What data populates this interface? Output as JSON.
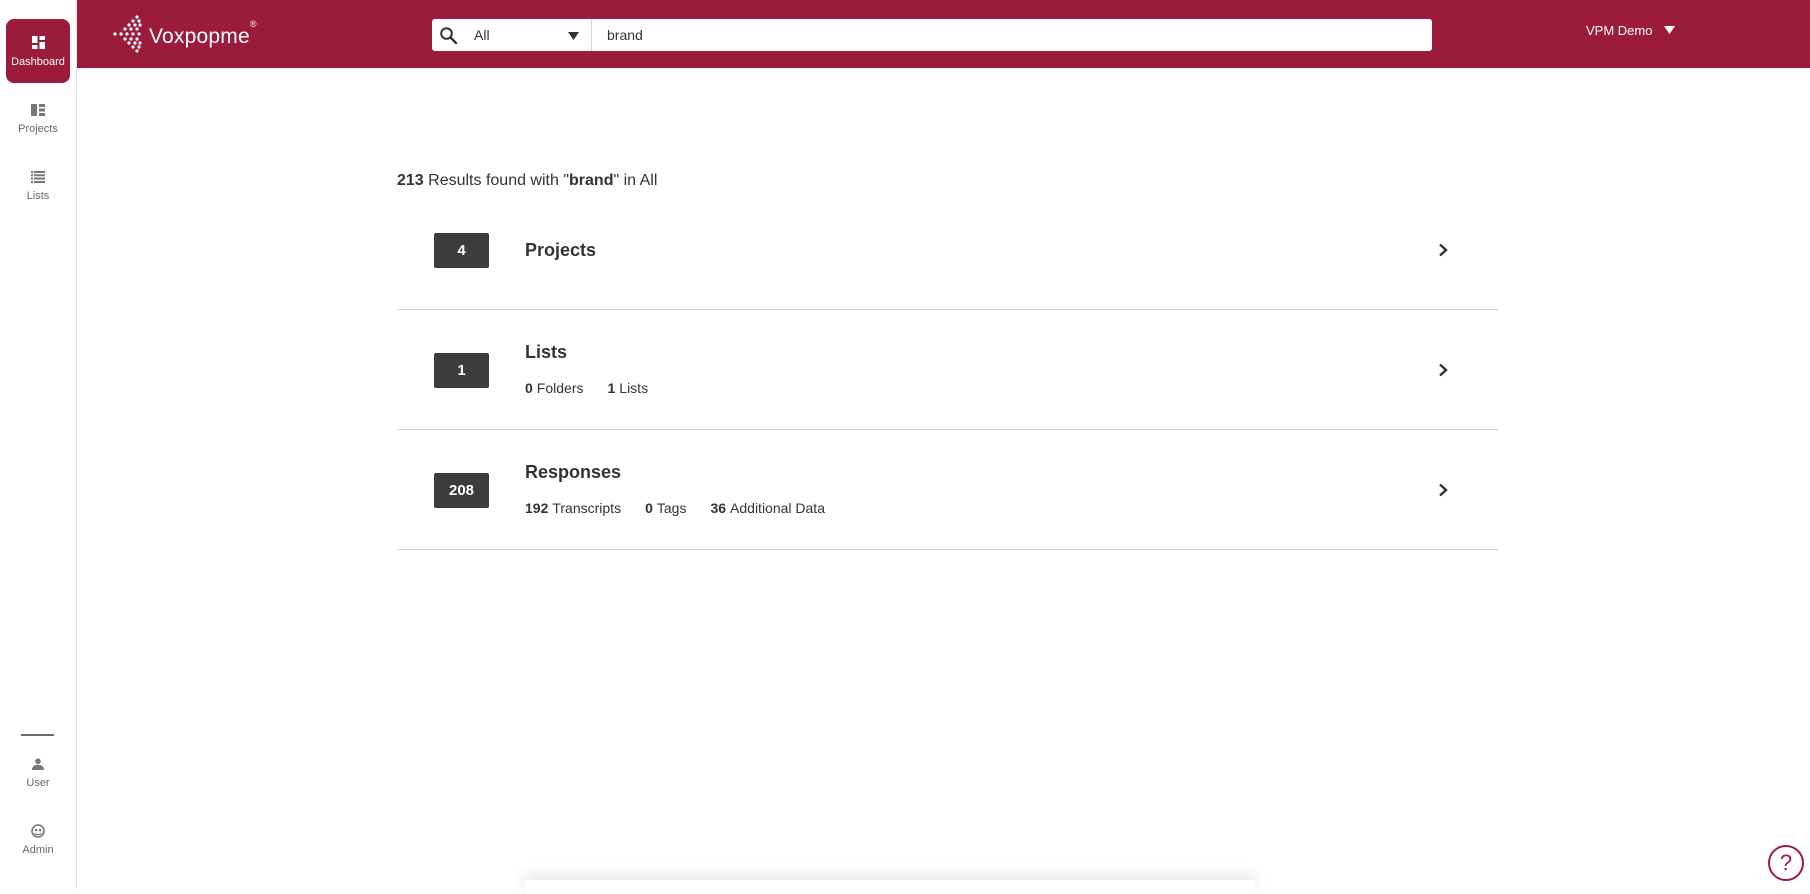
{
  "sidebar": {
    "items": [
      {
        "label": "Dashboard",
        "icon": "dashboard-icon"
      },
      {
        "label": "Projects",
        "icon": "projects-icon"
      },
      {
        "label": "Lists",
        "icon": "lists-icon"
      }
    ],
    "bottom_items": [
      {
        "label": "User",
        "icon": "user-icon"
      },
      {
        "label": "Admin",
        "icon": "admin-icon"
      }
    ]
  },
  "header": {
    "brand_name": "Voxpopme",
    "brand_reg": "®",
    "search": {
      "scope": "All",
      "query": "brand"
    },
    "user_name": "VPM Demo"
  },
  "summary": {
    "count": "213",
    "text_before": " Results found with \"",
    "query": "brand",
    "text_after": "\" in All"
  },
  "results": [
    {
      "count": "4",
      "title": "Projects",
      "stats": []
    },
    {
      "count": "1",
      "title": "Lists",
      "stats": [
        {
          "value": "0",
          "label": "Folders"
        },
        {
          "value": "1",
          "label": "Lists"
        }
      ]
    },
    {
      "count": "208",
      "title": "Responses",
      "stats": [
        {
          "value": "192",
          "label": "Transcripts"
        },
        {
          "value": "0",
          "label": "Tags"
        },
        {
          "value": "36",
          "label": "Additional Data"
        }
      ]
    }
  ],
  "help": {
    "label": "?"
  },
  "colors": {
    "brand": "#9b1b3c",
    "badge": "#3c3c3c"
  }
}
